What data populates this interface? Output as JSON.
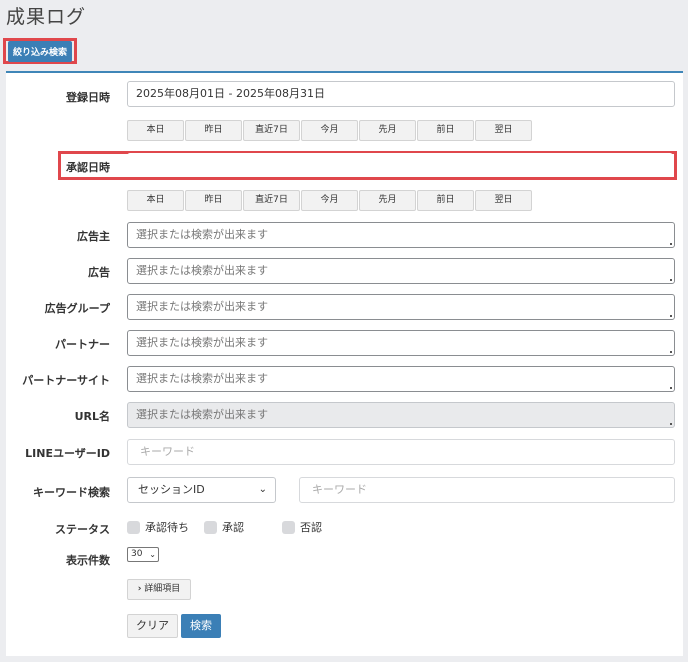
{
  "page_title": "成果ログ",
  "filter_toggle_label": "絞り込み検索",
  "quick_buttons": [
    "本日",
    "昨日",
    "直近7日",
    "今月",
    "先月",
    "前日",
    "翌日"
  ],
  "form": {
    "registered_label": "登録日時",
    "registered_value": "2025年08月01日 - 2025年08月31日",
    "approved_label": "承認日時",
    "approved_value": "",
    "advertiser_label": "広告主",
    "ad_label": "広告",
    "ad_group_label": "広告グループ",
    "partner_label": "パートナー",
    "partner_site_label": "パートナーサイト",
    "url_name_label": "URL名",
    "select_placeholder": "選択または検索が出来ます",
    "line_user_label": "LINEユーザーID",
    "keyword_placeholder": "キーワード",
    "keyword_search_label": "キーワード検索",
    "keyword_type_value": "セッションID",
    "status_label": "ステータス",
    "status_options": [
      "承認待ち",
      "承認",
      "否認"
    ],
    "per_page_label": "表示件数",
    "per_page_value": "30",
    "detail_label": "詳細項目",
    "clear_label": "クリア",
    "search_label": "検索"
  }
}
